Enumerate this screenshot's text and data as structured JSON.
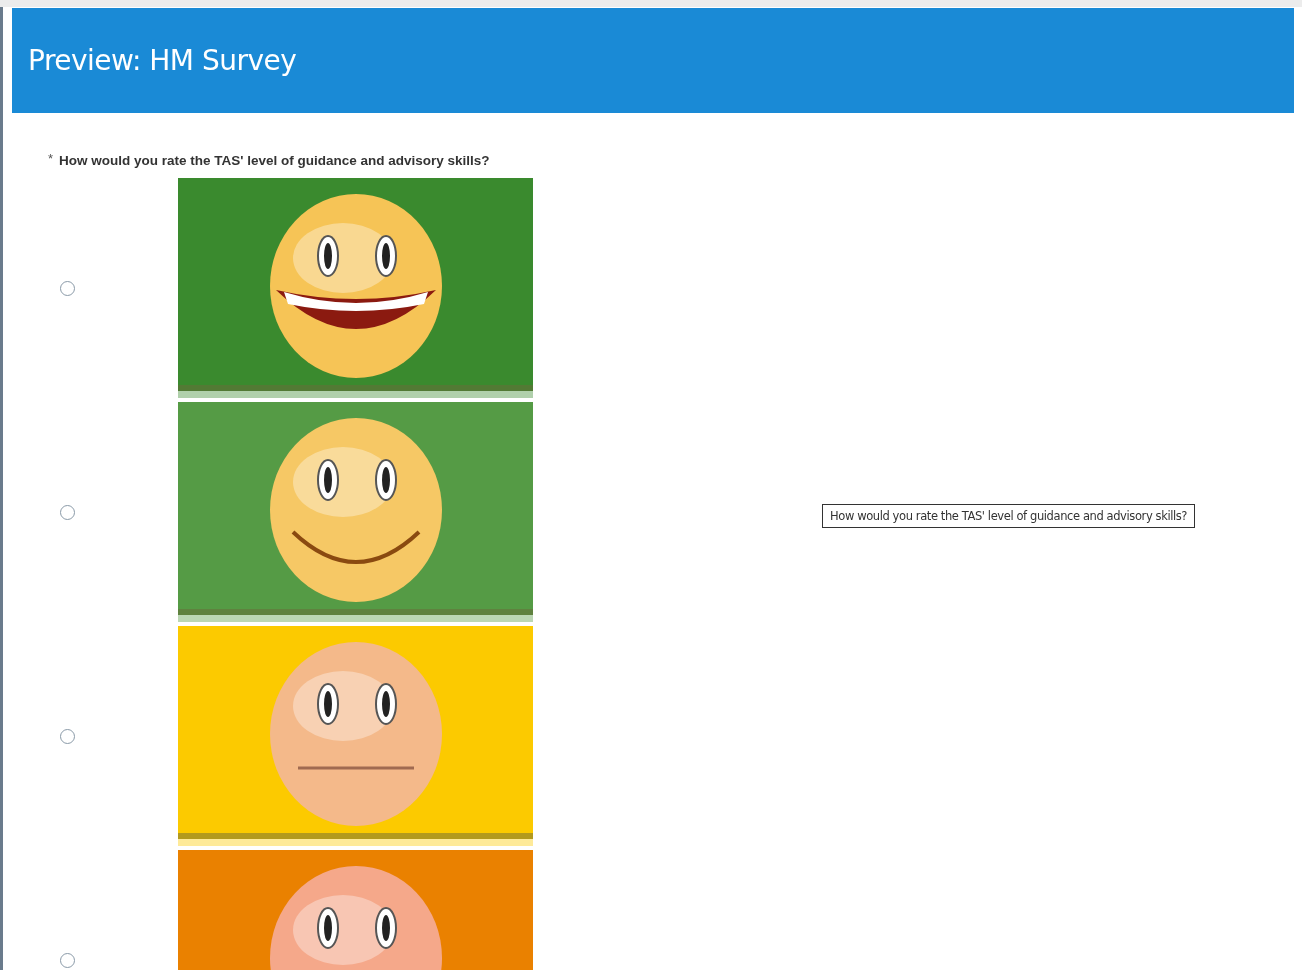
{
  "header": {
    "title": "Preview: HM Survey"
  },
  "question": {
    "required_mark": "*",
    "text": "How would you rate the TAS' level of guidance and advisory skills?"
  },
  "options": [
    {
      "kind": "laughing",
      "color": "#3a8a2e",
      "selected": false
    },
    {
      "kind": "smiling",
      "color": "#559b45",
      "selected": false
    },
    {
      "kind": "neutral",
      "color": "#fcca00",
      "selected": false
    },
    {
      "kind": "partial",
      "color": "#ea8100",
      "selected": false
    }
  ],
  "tooltip": {
    "text": "How would you rate the TAS' level of guidance and advisory skills?"
  }
}
